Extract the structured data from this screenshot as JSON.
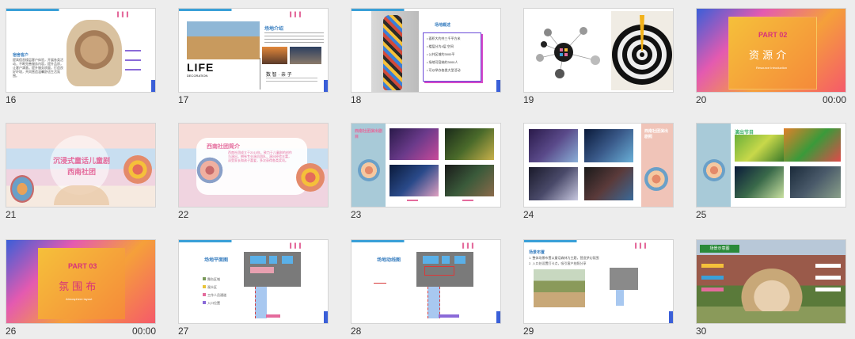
{
  "slides": [
    {
      "num": "16",
      "text": [
        "宿舍客户",
        "提高宿舍楼层客户体验，开展各类活动，不断完善服务内容，提升品质，让客户满意。提升服务质量，打造良好环境，共同营造温馨舒适生活氛围。"
      ]
    },
    {
      "num": "17",
      "title": "场地介绍",
      "life": "LIFE",
      "life_sub": "DECORATION",
      "cap": "数 智 · 亲 子"
    },
    {
      "num": "18",
      "title": "场地概述",
      "items": [
        "• 面积大约共三千平方米",
        "• 楼层分为4层 空间",
        "• 公共区域约3000平",
        "• 场地可容纳约3000人",
        "• 可以举办各类大型活动"
      ]
    },
    {
      "num": "19"
    },
    {
      "num": "20",
      "part": "PART 02",
      "title": "资 源 介",
      "sub": "Resource Introduction",
      "dur": "00:00"
    },
    {
      "num": "21",
      "title": "沉浸式童话儿童剧",
      "sub": "西南社团"
    },
    {
      "num": "22",
      "title": "西南社团简介",
      "body": "西南社团成立于2015年，致力于儿童剧的创作与演出，拥有专业演员团队，演出经验丰富，深受家长和孩子喜爱，多次获得各类奖项。"
    },
    {
      "num": "23",
      "title": "西南社团演出剧目"
    },
    {
      "num": "24",
      "title": "西南社团演出剧照"
    },
    {
      "num": "25",
      "title": "演出节目"
    },
    {
      "num": "26",
      "part": "PART 03",
      "title": "氛 围 布",
      "sub": "Atmosphere layout",
      "dur": "00:00"
    },
    {
      "num": "27",
      "title": "场地平面图",
      "legend": [
        "舞台区域",
        "观众区",
        "工作人员通道",
        "入口位置"
      ]
    },
    {
      "num": "28",
      "title": "场地动线图"
    },
    {
      "num": "29",
      "title": "场景布置",
      "bullets": [
        "1. 整体场景布置以童话森林为主题，营造梦幻氛围",
        "2. 入口处设置打卡点，吸引客户拍照分享"
      ]
    },
    {
      "num": "30",
      "title": "场景示意图"
    }
  ],
  "colors": {
    "accent": "#3aa0d8",
    "title": "#3a7fc0",
    "pink": "#e46b9c",
    "gold": "#f5c03a"
  }
}
